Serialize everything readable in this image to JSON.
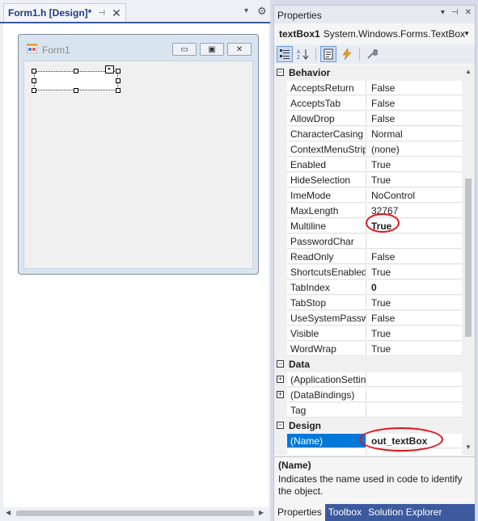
{
  "designer": {
    "tab_title": "Form1.h [Design]*",
    "pin_glyph": "⊣",
    "close_glyph": "✕",
    "dropdown_glyph": "▾",
    "gear_glyph": "⚙",
    "form": {
      "title": "Form1",
      "icon": "form-icon",
      "minimize_glyph": "▭",
      "maximize_glyph": "▣",
      "close_glyph": "✕"
    }
  },
  "properties": {
    "title": "Properties",
    "title_dropdown": "▾",
    "title_pin": "⊣",
    "title_close": "✕",
    "object_name": "textBox1",
    "object_type": "System.Windows.Forms.TextBox",
    "object_drop": "▼",
    "toolbar": {
      "categorized": "categorized-icon",
      "alphabetical": "alphabetical-icon",
      "properties": "properties-icon",
      "events": "events-icon",
      "property_pages": "wrench-icon"
    },
    "categories": {
      "behavior": "Behavior",
      "data": "Data",
      "design": "Design"
    },
    "behavior_rows": [
      {
        "name": "AcceptsReturn",
        "value": "False"
      },
      {
        "name": "AcceptsTab",
        "value": "False"
      },
      {
        "name": "AllowDrop",
        "value": "False"
      },
      {
        "name": "CharacterCasing",
        "value": "Normal"
      },
      {
        "name": "ContextMenuStrip",
        "value": "(none)"
      },
      {
        "name": "Enabled",
        "value": "True"
      },
      {
        "name": "HideSelection",
        "value": "True"
      },
      {
        "name": "ImeMode",
        "value": "NoControl"
      },
      {
        "name": "MaxLength",
        "value": "32767"
      },
      {
        "name": "Multiline",
        "value": "True"
      },
      {
        "name": "PasswordChar",
        "value": ""
      },
      {
        "name": "ReadOnly",
        "value": "False"
      },
      {
        "name": "ShortcutsEnabled",
        "value": "True"
      },
      {
        "name": "TabIndex",
        "value": "0"
      },
      {
        "name": "TabStop",
        "value": "True"
      },
      {
        "name": "UseSystemPasswo",
        "value": "False"
      },
      {
        "name": "Visible",
        "value": "True"
      },
      {
        "name": "WordWrap",
        "value": "True"
      }
    ],
    "data_rows": [
      {
        "name": "(ApplicationSettin",
        "value": ""
      },
      {
        "name": "(DataBindings)",
        "value": ""
      },
      {
        "name": "Tag",
        "value": ""
      }
    ],
    "design_rows": [
      {
        "name": "(Name)",
        "value": "out_textBox"
      }
    ],
    "description": {
      "title": "(Name)",
      "text": "Indicates the name used in code to identify the object."
    },
    "bottom_tabs": [
      "Properties",
      "Toolbox",
      "Solution Explorer"
    ],
    "colors": {
      "accent": "#3d5a9e",
      "selection": "#0078d7",
      "annotation": "#e0151b"
    }
  }
}
